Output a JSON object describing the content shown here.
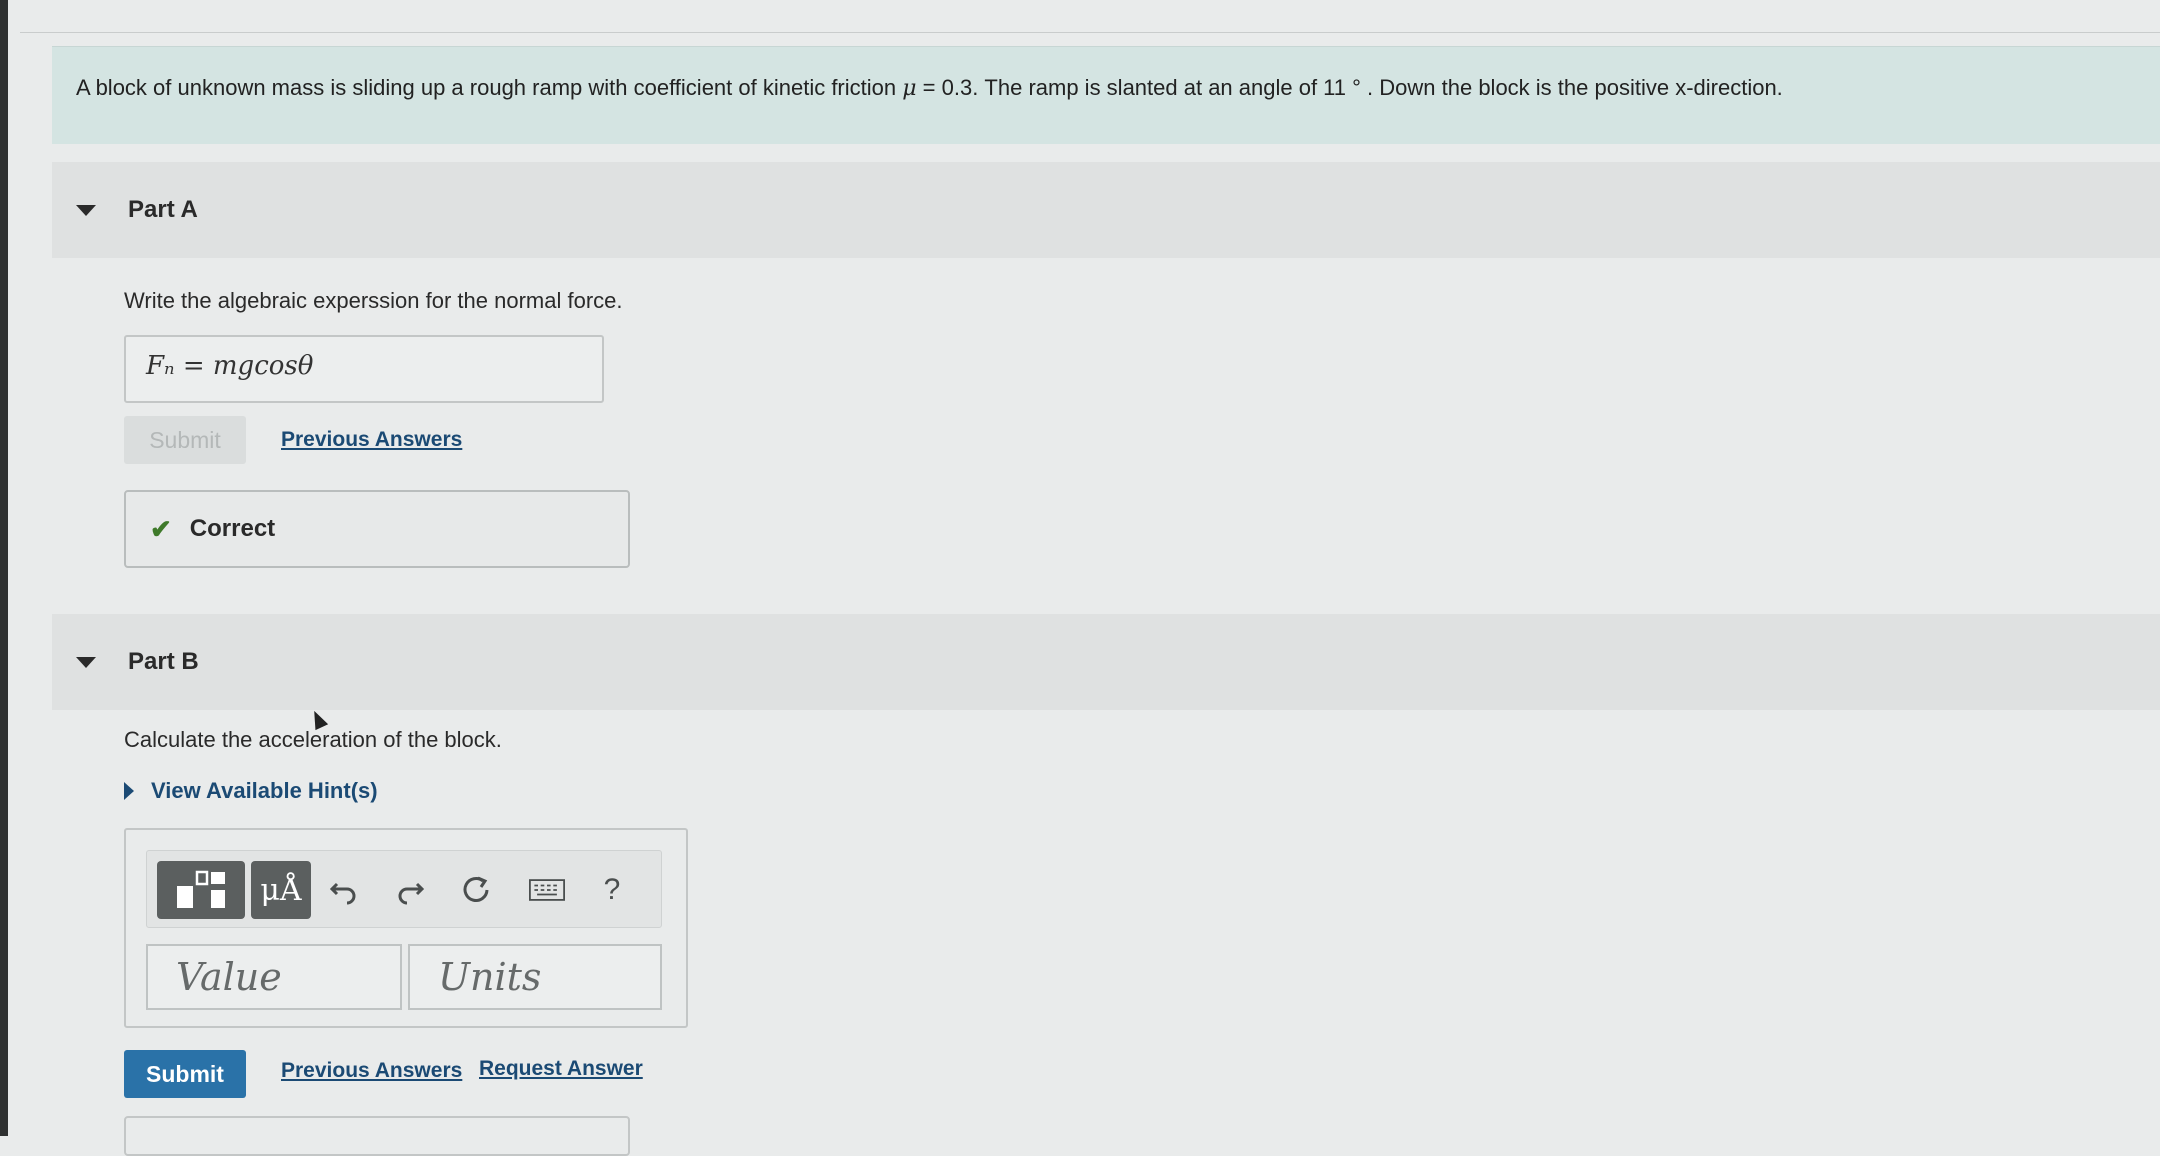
{
  "problem": {
    "text_before_mu": "A block of unknown mass is sliding up a rough ramp with coefficient of kinetic friction ",
    "mu_symbol": "μ",
    "text_after_mu": " = 0.3.  The ramp is slanted at an angle of 11 °  .  Down the block is the positive x-direction."
  },
  "part_a": {
    "title": "Part A",
    "prompt": "Write the algebraic experssion for the normal force.",
    "answer": "Fₙ = mgcosθ",
    "submit_label": "Submit",
    "previous_answers_label": "Previous Answers",
    "feedback": "Correct"
  },
  "part_b": {
    "title": "Part B",
    "prompt": "Calculate the acceleration of the block.",
    "hints_label": "View Available Hint(s)",
    "toolbar": {
      "templates_icon": "templates-icon",
      "units_label": "μÅ",
      "undo_icon": "undo-icon",
      "redo_icon": "redo-icon",
      "reset_icon": "reset-icon",
      "keyboard_icon": "keyboard-icon",
      "help_label": "?"
    },
    "value_placeholder": "Value",
    "units_placeholder": "Units",
    "submit_label": "Submit",
    "previous_answers_label": "Previous Answers",
    "request_answer_label": "Request Answer"
  }
}
